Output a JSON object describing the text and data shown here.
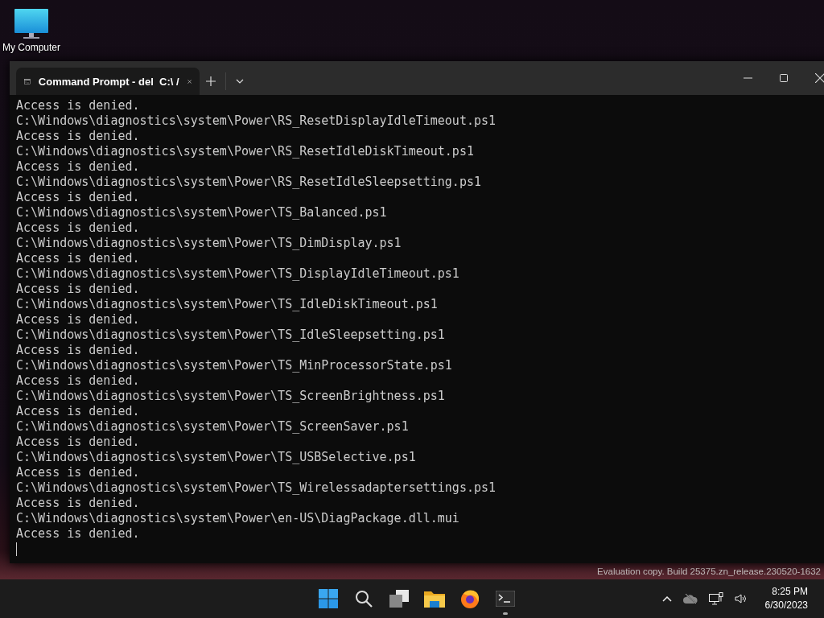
{
  "desktop_icons": [
    {
      "label": "My Computer"
    }
  ],
  "window": {
    "tabs": [
      {
        "title": "Command Prompt - del  C:\\ /",
        "selected": true
      }
    ],
    "lines": [
      "Access is denied.",
      "C:\\Windows\\diagnostics\\system\\Power\\RS_ResetDisplayIdleTimeout.ps1",
      "Access is denied.",
      "C:\\Windows\\diagnostics\\system\\Power\\RS_ResetIdleDiskTimeout.ps1",
      "Access is denied.",
      "C:\\Windows\\diagnostics\\system\\Power\\RS_ResetIdleSleepsetting.ps1",
      "Access is denied.",
      "C:\\Windows\\diagnostics\\system\\Power\\TS_Balanced.ps1",
      "Access is denied.",
      "C:\\Windows\\diagnostics\\system\\Power\\TS_DimDisplay.ps1",
      "Access is denied.",
      "C:\\Windows\\diagnostics\\system\\Power\\TS_DisplayIdleTimeout.ps1",
      "Access is denied.",
      "C:\\Windows\\diagnostics\\system\\Power\\TS_IdleDiskTimeout.ps1",
      "Access is denied.",
      "C:\\Windows\\diagnostics\\system\\Power\\TS_IdleSleepsetting.ps1",
      "Access is denied.",
      "C:\\Windows\\diagnostics\\system\\Power\\TS_MinProcessorState.ps1",
      "Access is denied.",
      "C:\\Windows\\diagnostics\\system\\Power\\TS_ScreenBrightness.ps1",
      "Access is denied.",
      "C:\\Windows\\diagnostics\\system\\Power\\TS_ScreenSaver.ps1",
      "Access is denied.",
      "C:\\Windows\\diagnostics\\system\\Power\\TS_USBSelective.ps1",
      "Access is denied.",
      "C:\\Windows\\diagnostics\\system\\Power\\TS_Wirelessadaptersettings.ps1",
      "Access is denied.",
      "C:\\Windows\\diagnostics\\system\\Power\\en-US\\DiagPackage.dll.mui",
      "Access is denied."
    ]
  },
  "watermark": "Evaluation copy. Build 25375.zn_release.230520-1632",
  "taskbar": {
    "apps": [
      {
        "kind": "start",
        "running": false
      },
      {
        "kind": "search",
        "running": false
      },
      {
        "kind": "taskview",
        "running": false
      },
      {
        "kind": "explorer",
        "running": false
      },
      {
        "kind": "firefox",
        "running": false
      },
      {
        "kind": "terminal",
        "running": true
      }
    ],
    "time": "8:25 PM",
    "date": "6/30/2023"
  }
}
